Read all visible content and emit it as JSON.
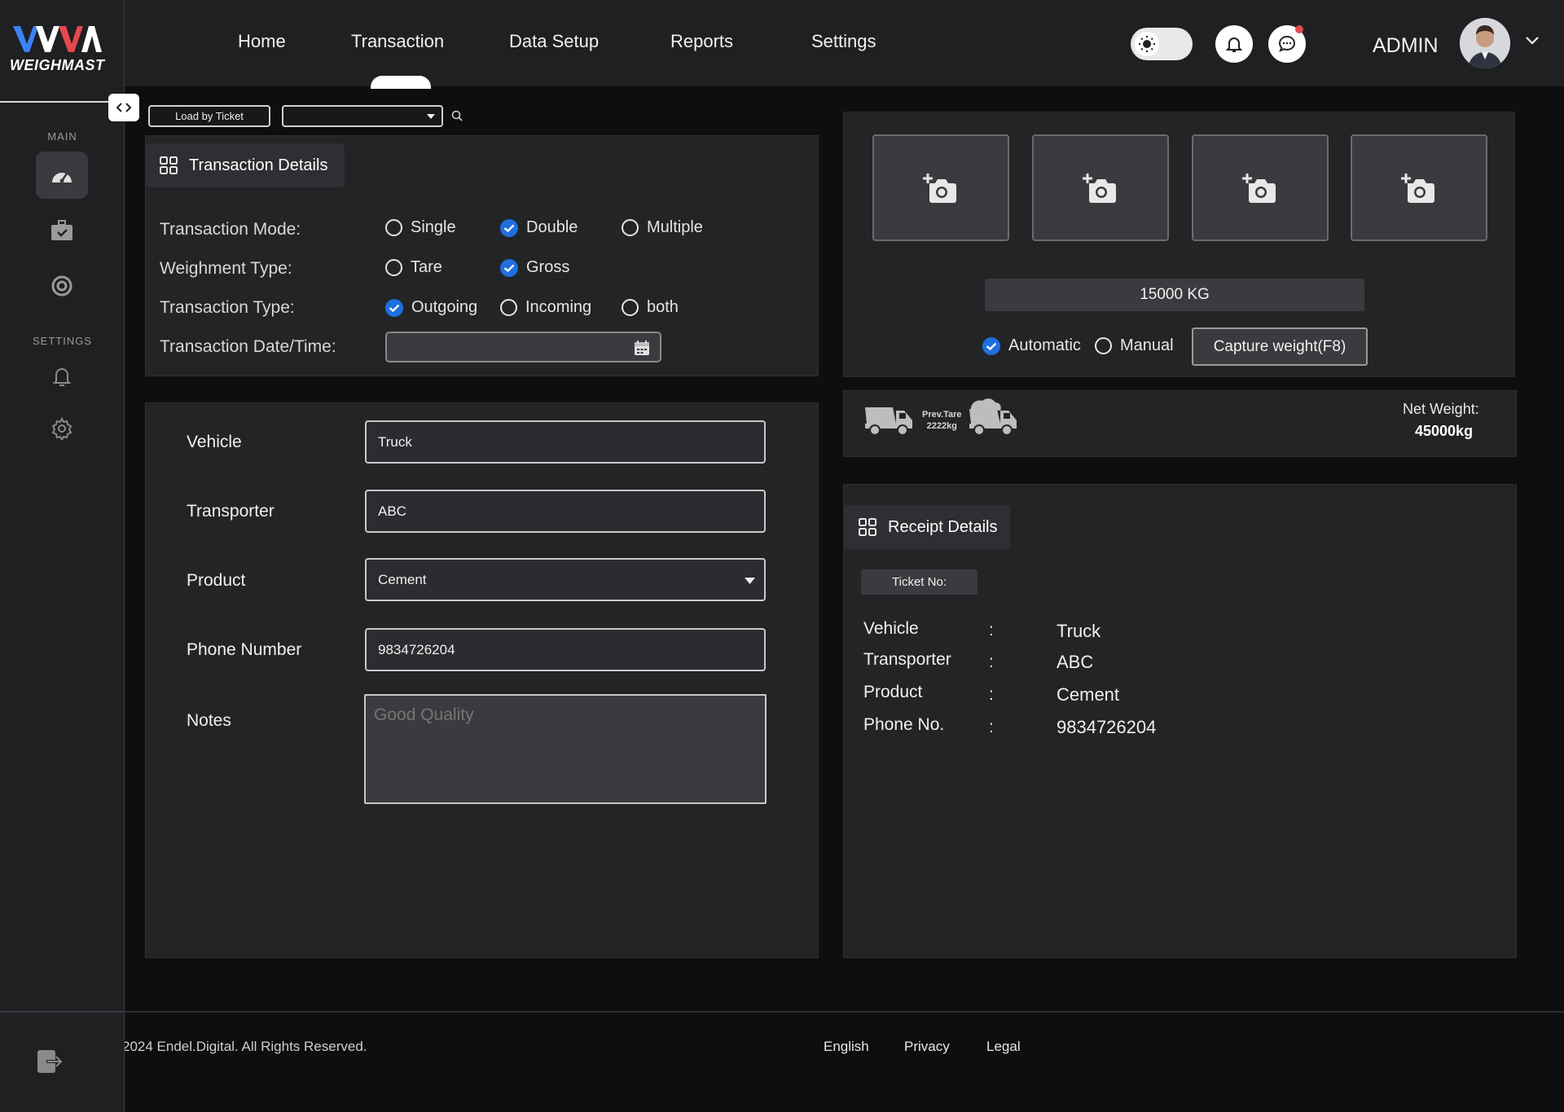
{
  "brand": {
    "logo_text": "WEIGHMAST"
  },
  "nav": [
    {
      "label": "Home"
    },
    {
      "label": "Transaction"
    },
    {
      "label": "Data Setup"
    },
    {
      "label": "Reports"
    },
    {
      "label": "Settings"
    }
  ],
  "user": {
    "name": "ADMIN"
  },
  "sidebar": {
    "main_label": "MAIN",
    "settings_label": "SETTINGS"
  },
  "toolbar": {
    "load_button": "Load by Ticket",
    "ticket_select": ""
  },
  "transaction_details": {
    "title": "Transaction Details",
    "mode_label": "Transaction Mode:",
    "mode_options": [
      "Single",
      "Double",
      "Multiple"
    ],
    "mode_selected": "Double",
    "weighment_label": "Weighment Type:",
    "weighment_options": [
      "Tare",
      "Gross"
    ],
    "weighment_selected": "Gross",
    "type_label": "Transaction Type:",
    "type_options": [
      "Outgoing",
      "Incoming",
      "both"
    ],
    "type_selected": "Outgoing",
    "date_label": "Transaction Date/Time:",
    "date_value": ""
  },
  "form": {
    "vehicle_label": "Vehicle",
    "vehicle_value": "Truck",
    "transporter_label": "Transporter",
    "transporter_value": "ABC",
    "product_label": "Product",
    "product_value": "Cement",
    "phone_label": "Phone Number",
    "phone_value": "9834726204",
    "notes_label": "Notes",
    "notes_placeholder": "Good Quality"
  },
  "weight": {
    "display": "15000 KG",
    "mode_options": [
      "Automatic",
      "Manual"
    ],
    "mode_selected": "Automatic",
    "capture_button": "Capture weight(F8)"
  },
  "tare": {
    "prev_label": "Prev.Tare",
    "prev_value": "2222kg",
    "net_label": "Net Weight:",
    "net_value": "45000kg"
  },
  "receipt": {
    "title": "Receipt Details",
    "ticket_label": "Ticket No:",
    "rows": [
      {
        "label": "Vehicle",
        "value": "Truck"
      },
      {
        "label": "Transporter",
        "value": "ABC"
      },
      {
        "label": "Product",
        "value": "Cement"
      },
      {
        "label": "Phone No.",
        "value": "9834726204"
      }
    ],
    "separator": ":"
  },
  "footer": {
    "copyright": "2024 Endel.Digital. All Rights Reserved.",
    "links": [
      "English",
      "Privacy",
      "Legal"
    ]
  },
  "colors": {
    "accent": "#1f6fe0",
    "notification_dot": "#e5484d",
    "panel": "#232426"
  }
}
